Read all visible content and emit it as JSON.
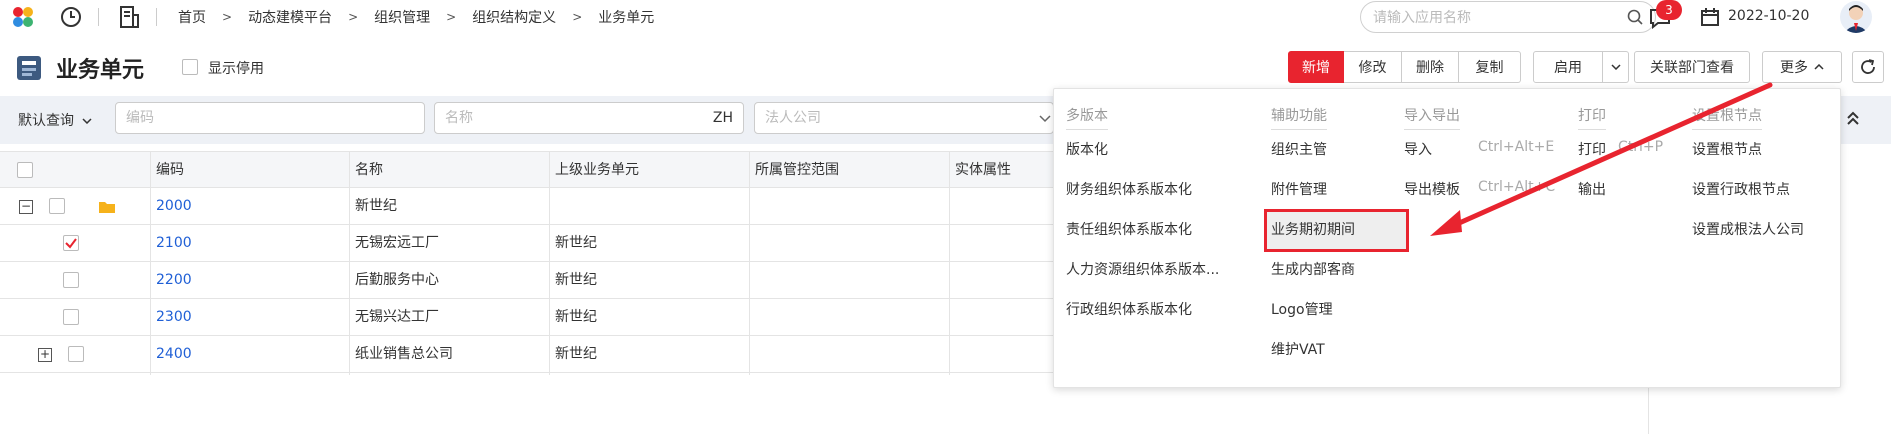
{
  "breadcrumb": [
    "首页",
    "动态建模平台",
    "组织管理",
    "组织结构定义",
    "业务单元"
  ],
  "search": {
    "placeholder": "请输入应用名称"
  },
  "notifications": {
    "count": "3"
  },
  "date": "2022-10-20",
  "page": {
    "title": "业务单元",
    "show_disabled_label": "显示停用"
  },
  "toolbar": {
    "new": "新增",
    "edit": "修改",
    "delete": "删除",
    "copy": "复制",
    "enable": "启用",
    "linked_dept": "关联部门查看",
    "more": "更多"
  },
  "filters": {
    "query_label": "默认查询",
    "code_placeholder": "编码",
    "name_placeholder": "名称",
    "lang": "ZH",
    "legal_company_placeholder": "法人公司"
  },
  "table": {
    "columns": [
      "编码",
      "名称",
      "上级业务单元",
      "所属管控范围",
      "实体属性"
    ],
    "rows": [
      {
        "code": "2000",
        "name": "新世纪",
        "parent": "",
        "expander": "−",
        "folder": true,
        "checked": false
      },
      {
        "code": "2100",
        "name": "无锡宏远工厂",
        "parent": "新世纪",
        "expander": "",
        "folder": false,
        "checked": true
      },
      {
        "code": "2200",
        "name": "后勤服务中心",
        "parent": "新世纪",
        "expander": "",
        "folder": false,
        "checked": false
      },
      {
        "code": "2300",
        "name": "无锡兴达工厂",
        "parent": "新世纪",
        "expander": "",
        "folder": false,
        "checked": false
      },
      {
        "code": "2400",
        "name": "纸业销售总公司",
        "parent": "新世纪",
        "expander": "+",
        "folder": false,
        "checked": false
      }
    ]
  },
  "more_menu": {
    "columns": [
      {
        "header": "多版本",
        "items": [
          "版本化",
          "财务组织体系版本化",
          "责任组织体系版本化",
          "人力资源组织体系版本...",
          "行政组织体系版本化"
        ]
      },
      {
        "header": "辅助功能",
        "items": [
          "组织主管",
          "附件管理",
          "业务期初期间",
          "生成内部客商",
          "Logo管理",
          "维护VAT"
        ]
      },
      {
        "header": "导入导出",
        "items": [
          "导入",
          "导出模板"
        ],
        "shortcuts": [
          "Ctrl+Alt+E",
          "Ctrl+Alt+C"
        ]
      },
      {
        "header": "打印",
        "items": [
          "打印",
          "输出"
        ],
        "shortcuts": [
          "Ctrl+P"
        ]
      },
      {
        "header": "设置根节点",
        "items": [
          "设置根节点",
          "设置行政根节点",
          "设置成根法人公司"
        ]
      }
    ],
    "highlighted_item": "业务期初期间"
  },
  "colors": {
    "accent": "#e8242f",
    "link": "#1f5fd6"
  }
}
